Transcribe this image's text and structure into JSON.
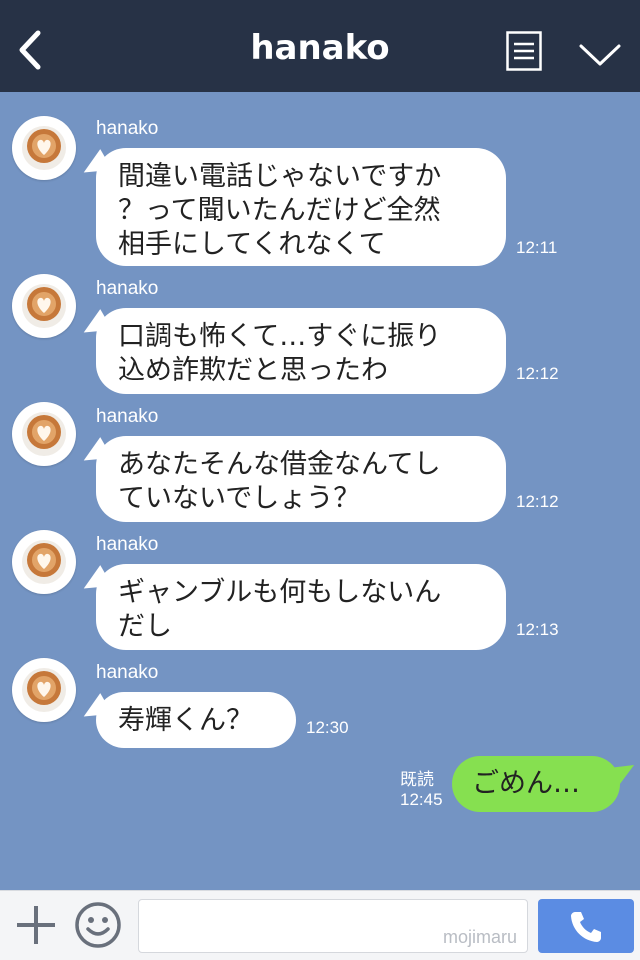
{
  "header": {
    "title": "hanako"
  },
  "messages": [
    {
      "sender": "hanako",
      "text": "間違い電話じゃないですか\n？って聞いたんだけど全然\n相手にしてくれなくて",
      "time": "12:11"
    },
    {
      "sender": "hanako",
      "text": "口調も怖くて…すぐに振り\n込め詐欺だと思ったわ",
      "time": "12:12"
    },
    {
      "sender": "hanako",
      "text": "あなたそんな借金なんてし\nていないでしょう？",
      "time": "12:12"
    },
    {
      "sender": "hanako",
      "text": "ギャンブルも何もしないん\nだし",
      "time": "12:13"
    },
    {
      "sender": "hanako",
      "text": "寿輝くん？",
      "time": "12:30"
    }
  ],
  "outgoing": {
    "text": "ごめん…",
    "read_label": "既読",
    "time": "12:45"
  },
  "input": {
    "placeholder": "",
    "watermark": "mojimaru"
  },
  "icons": {
    "back": "chevron-left-icon",
    "menu": "menu-list-icon",
    "collapse": "chevron-down-icon",
    "plus": "plus-icon",
    "emoji": "smiley-icon",
    "call": "phone-icon"
  },
  "colors": {
    "header_bg": "#273246",
    "chat_bg": "#7494c3",
    "outgoing_bubble": "#86e050",
    "call_button": "#5b8ce3"
  }
}
